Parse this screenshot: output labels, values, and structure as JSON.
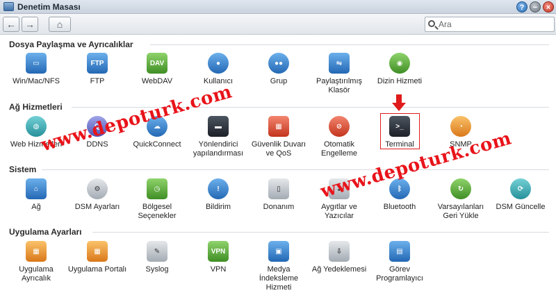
{
  "window": {
    "title": "Denetim Masası"
  },
  "toolbar": {
    "back": "←",
    "forward": "→",
    "home": "⌂",
    "search_placeholder": "Ara"
  },
  "window_buttons": {
    "help": "?",
    "minimize": "−",
    "close": "×"
  },
  "sections": [
    {
      "title": "Dosya Paylaşma ve Ayrıcalıklar",
      "items": [
        {
          "label": "Win/Mac/NFS",
          "icon": "monitor-icon",
          "glyph": "▭"
        },
        {
          "label": "FTP",
          "icon": "ftp-icon",
          "glyph": "FTP"
        },
        {
          "label": "WebDAV",
          "icon": "webdav-icon",
          "glyph": "DAV"
        },
        {
          "label": "Kullanıcı",
          "icon": "user-icon",
          "glyph": "●"
        },
        {
          "label": "Grup",
          "icon": "group-icon",
          "glyph": "●●"
        },
        {
          "label": "Paylaştırılmış Klasör",
          "icon": "shared-folder-icon",
          "glyph": "⇋"
        },
        {
          "label": "Dizin Hizmeti",
          "icon": "directory-service-icon",
          "glyph": "◉"
        }
      ]
    },
    {
      "title": "Ağ Hizmetleri",
      "items": [
        {
          "label": "Web Hizmetleri",
          "icon": "globe-icon",
          "glyph": "◍"
        },
        {
          "label": "DDNS",
          "icon": "ddns-icon",
          "glyph": "Q"
        },
        {
          "label": "QuickConnect",
          "icon": "cloud-icon",
          "glyph": "☁"
        },
        {
          "label": "Yönlendirici yapılandırması",
          "icon": "router-icon",
          "glyph": "▬"
        },
        {
          "label": "Güvenlik Duvarı ve QoS",
          "icon": "firewall-icon",
          "glyph": "▦"
        },
        {
          "label": "Otomatik Engelleme",
          "icon": "block-icon",
          "glyph": "⊘"
        },
        {
          "label": "Terminal",
          "icon": "terminal-icon",
          "glyph": ">_"
        },
        {
          "label": "SNMP",
          "icon": "pie-chart-icon",
          "glyph": "◔"
        }
      ]
    },
    {
      "title": "Sistem",
      "items": [
        {
          "label": "Ağ",
          "icon": "home-network-icon",
          "glyph": "⌂"
        },
        {
          "label": "DSM Ayarları",
          "icon": "gear-icon",
          "glyph": "⚙"
        },
        {
          "label": "Bölgesel Seçenekler",
          "icon": "clock-map-icon",
          "glyph": "◷"
        },
        {
          "label": "Bildirim",
          "icon": "notification-icon",
          "glyph": "!"
        },
        {
          "label": "Donanım",
          "icon": "hardware-icon",
          "glyph": "▯"
        },
        {
          "label": "Aygıtlar ve Yazıcılar",
          "icon": "usb-icon",
          "glyph": "⇣"
        },
        {
          "label": "Bluetooth",
          "icon": "bluetooth-icon",
          "glyph": "ᛒ"
        },
        {
          "label": "Varsayılanları Geri Yükle",
          "icon": "restore-icon",
          "glyph": "↻"
        },
        {
          "label": "DSM Güncelle",
          "icon": "update-icon",
          "glyph": "⟳"
        }
      ]
    },
    {
      "title": "Uygulama Ayarları",
      "items": [
        {
          "label": "Uygulama Ayrıcalık",
          "icon": "app-privilege-icon",
          "glyph": "▦"
        },
        {
          "label": "Uygulama Portalı",
          "icon": "app-portal-icon",
          "glyph": "▦"
        },
        {
          "label": "Syslog",
          "icon": "syslog-icon",
          "glyph": "✎"
        },
        {
          "label": "VPN",
          "icon": "vpn-icon",
          "glyph": "VPN"
        },
        {
          "label": "Medya İndeksleme Hizmeti",
          "icon": "media-index-icon",
          "glyph": "▣"
        },
        {
          "label": "Ağ Yedeklemesi",
          "icon": "network-backup-icon",
          "glyph": "⇩"
        },
        {
          "label": "Görev Programlayıcı",
          "icon": "task-scheduler-icon",
          "glyph": "▤"
        }
      ]
    }
  ],
  "watermarks": [
    "www.depoturk.com",
    "www.depoturk.com"
  ],
  "colors": {
    "highlight": "#e01a1a",
    "watermark": "#e8141a"
  }
}
